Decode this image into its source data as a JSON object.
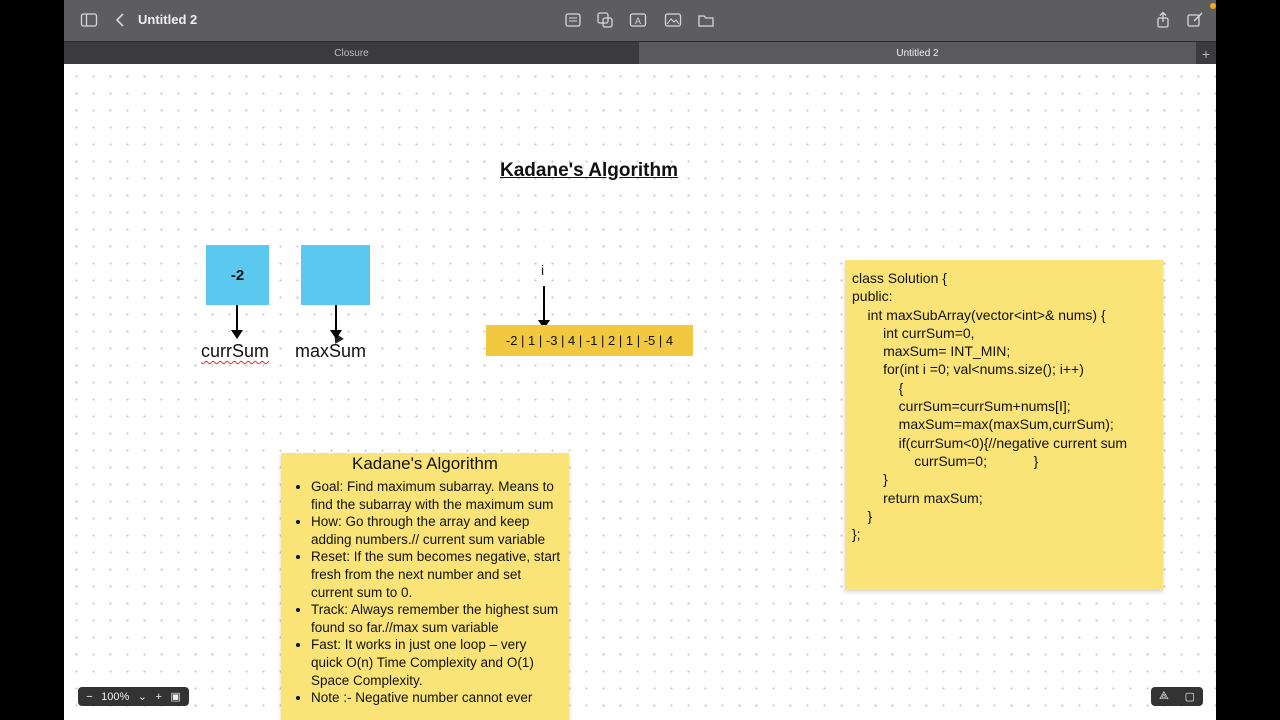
{
  "window": {
    "title": "Untitled 2"
  },
  "tabs": [
    {
      "label": "Closure",
      "active": false
    },
    {
      "label": "Untitled 2",
      "active": true
    }
  ],
  "canvas": {
    "title": "Kadane's Algorithm",
    "boxes": [
      {
        "value": "-2",
        "label": "currSum"
      },
      {
        "value": "",
        "label": "maxSum"
      }
    ],
    "pointer_label": "i",
    "array": "-2 | 1 | -3 | 4 | -1 | 2 | 1 | -5 | 4",
    "note1": {
      "heading": "Kadane's Algorithm",
      "items": [
        "Goal: Find maximum subarray. Means to find the subarray with the maximum sum",
        "How: Go through the array and keep adding numbers.// current sum variable",
        "Reset: If the sum becomes negative, start fresh from the next number and set current sum to 0.",
        "Track: Always remember the highest sum found so far.//max sum variable",
        "Fast: It works in just one loop – very quick O(n) Time Complexity  and  O(1) Space Complexity.",
        "Note :- Negative number cannot ever"
      ]
    },
    "code_lines": [
      "class Solution {",
      "public:",
      "    int maxSubArray(vector<int>& nums) {",
      "        int currSum=0,",
      "        maxSum= INT_MIN;",
      "",
      "        for(int i =0; val<nums.size(); i++)",
      "            {",
      "            currSum=currSum+nums[I];",
      "            maxSum=max(maxSum,currSum);",
      "",
      "            if(currSum<0){//negative current sum",
      "                currSum=0;            }",
      "        }",
      "        return maxSum;",
      "    }",
      "};"
    ]
  },
  "zoom": {
    "level": "100%"
  },
  "colors": {
    "box": "#5bc8ef",
    "array_bar": "#f1c83f",
    "sticky": "#fbe477",
    "toolbar": "#5d5d5f"
  }
}
